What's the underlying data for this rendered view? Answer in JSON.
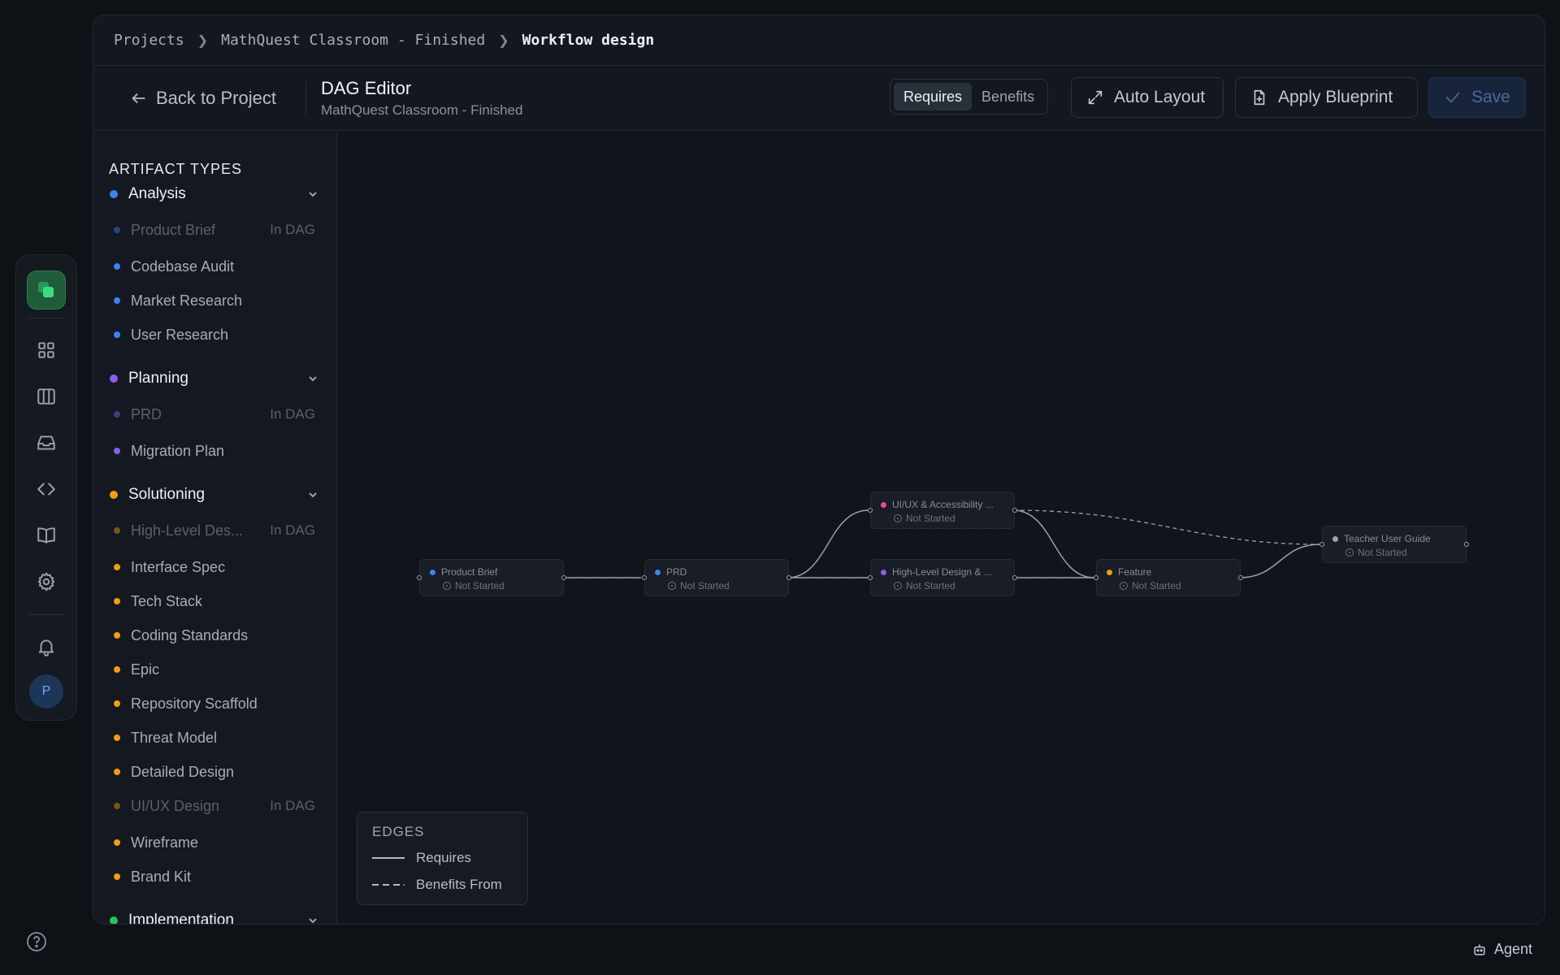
{
  "breadcrumb": [
    "Projects",
    "MathQuest Classroom - Finished",
    "Workflow design"
  ],
  "header": {
    "back_label": "Back to Project",
    "title": "DAG Editor",
    "subtitle": "MathQuest Classroom - Finished",
    "toggle": [
      "Requires",
      "Benefits"
    ],
    "toggle_active": "Requires",
    "auto_layout": "Auto Layout",
    "apply_blueprint": "Apply Blueprint",
    "save": "Save"
  },
  "rail": {
    "icons": [
      "logo-icon",
      "grid-icon",
      "columns-icon",
      "inbox-icon",
      "code-icon",
      "book-icon",
      "gear-icon",
      "bell-icon"
    ],
    "avatar": "P"
  },
  "sidebar": {
    "title": "ARTIFACT TYPES",
    "groups": [
      {
        "name": "Analysis",
        "color": "#3b82f6",
        "items": [
          {
            "label": "Product Brief",
            "in_dag": true
          },
          {
            "label": "Codebase Audit",
            "in_dag": false
          },
          {
            "label": "Market Research",
            "in_dag": false
          },
          {
            "label": "User Research",
            "in_dag": false
          }
        ]
      },
      {
        "name": "Planning",
        "color": "#8b5cf6",
        "items": [
          {
            "label": "PRD",
            "in_dag": true
          },
          {
            "label": "Migration Plan",
            "in_dag": false
          }
        ]
      },
      {
        "name": "Solutioning",
        "color": "#f59e0b",
        "items": [
          {
            "label": "High-Level Des...",
            "in_dag": true
          },
          {
            "label": "Interface Spec",
            "in_dag": false
          },
          {
            "label": "Tech Stack",
            "in_dag": false
          },
          {
            "label": "Coding Standards",
            "in_dag": false
          },
          {
            "label": "Epic",
            "in_dag": false
          },
          {
            "label": "Repository Scaffold",
            "in_dag": false
          },
          {
            "label": "Threat Model",
            "in_dag": false
          },
          {
            "label": "Detailed Design",
            "in_dag": false
          },
          {
            "label": "UI/UX Design",
            "in_dag": true
          },
          {
            "label": "Wireframe",
            "in_dag": false
          },
          {
            "label": "Brand Kit",
            "in_dag": false
          }
        ]
      },
      {
        "name": "Implementation",
        "color": "#22c55e",
        "items": []
      }
    ],
    "in_dag_tag": "In DAG"
  },
  "nodes": [
    {
      "id": "product-brief",
      "label": "Product Brief",
      "status": "Not Started",
      "color": "#3b82f6"
    },
    {
      "id": "prd",
      "label": "PRD",
      "status": "Not Started",
      "color": "#3b82f6"
    },
    {
      "id": "uiux",
      "label": "UI/UX & Accessibility ...",
      "status": "Not Started",
      "color": "#ec4899"
    },
    {
      "id": "hld",
      "label": "High-Level Design & ...",
      "status": "Not Started",
      "color": "#8b5cf6"
    },
    {
      "id": "feature",
      "label": "Feature",
      "status": "Not Started",
      "color": "#f59e0b"
    },
    {
      "id": "teacher-guide",
      "label": "Teacher User Guide",
      "status": "Not Started",
      "color": "#9ca3af"
    }
  ],
  "legend": {
    "title": "EDGES",
    "requires": "Requires",
    "benefits": "Benefits From"
  },
  "agent_label": "Agent"
}
